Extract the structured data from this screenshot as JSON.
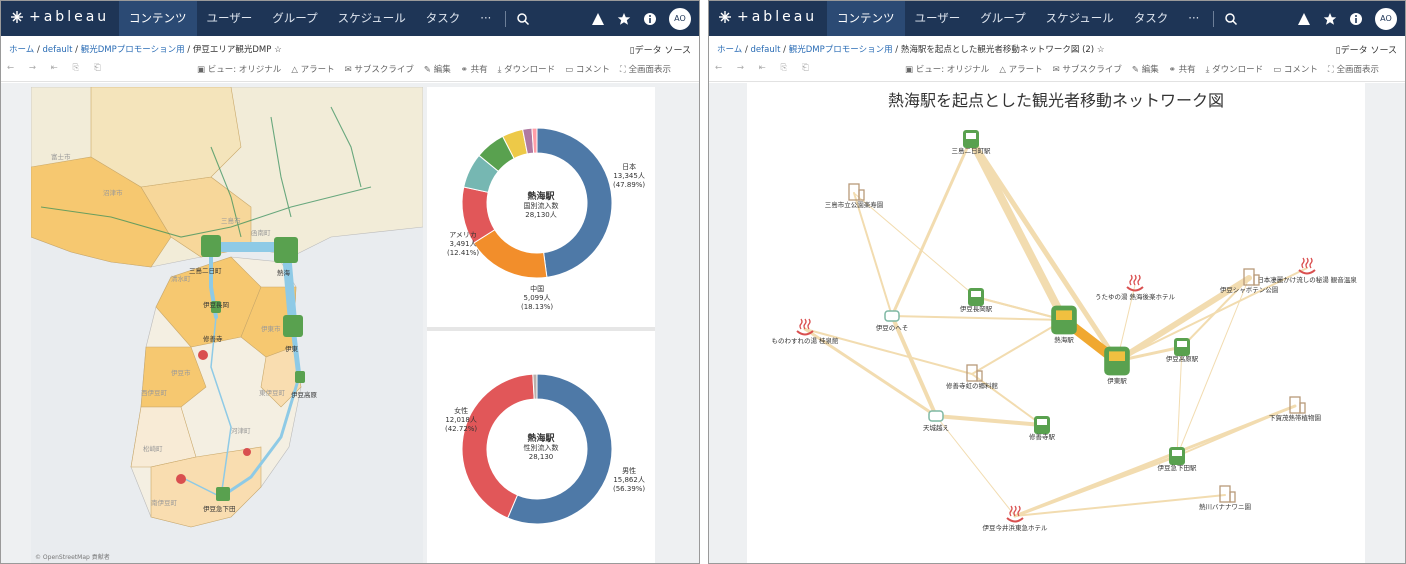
{
  "app": {
    "logo_text": "+ableau",
    "avatar": "AO"
  },
  "nav": {
    "items": [
      "コンテンツ",
      "ユーザー",
      "グループ",
      "スケジュール",
      "タスク",
      "···"
    ]
  },
  "left": {
    "breadcrumb": {
      "home": "ホーム",
      "site": "default",
      "project": "観光DMPプロモーション用",
      "view": "伊豆エリア観光DMP"
    },
    "data_source": "データ ソース",
    "toolbar": [
      "ビュー: オリジナル",
      "アラート",
      "サブスクライブ",
      "編集",
      "共有",
      "ダウンロード",
      "コメント",
      "全画面表示"
    ],
    "map_labels": [
      "三島二日町",
      "熱海",
      "伊豆長岡",
      "修善寺",
      "伊東",
      "伊豆高原",
      "伊豆急下田"
    ],
    "map_places": [
      "富士市",
      "沼津市",
      "伊豆市",
      "伊東市",
      "東伊豆町",
      "河津町",
      "南伊豆町",
      "松崎町",
      "西伊豆町",
      "三島市",
      "函南町",
      "清水町"
    ],
    "attribution": "© OpenStreetMap 貢献者",
    "donut1": {
      "center_title": "熱海駅",
      "center_sub": "国別流入数",
      "center_value": "28,130人",
      "slices": [
        {
          "name": "日本",
          "value": "13,345人",
          "pct": "(47.89%)",
          "color": "#4e79a7"
        },
        {
          "name": "中国",
          "value": "5,099人",
          "pct": "(18.13%)",
          "color": "#f28e2b"
        },
        {
          "name": "アメリカ",
          "value": "3,491人",
          "pct": "(12.41%)",
          "color": "#e15759"
        },
        {
          "name": "",
          "value": "",
          "pct": "",
          "color": "#76b7b2"
        },
        {
          "name": "",
          "value": "",
          "pct": "",
          "color": "#59a14f"
        },
        {
          "name": "",
          "value": "",
          "pct": "",
          "color": "#edc948"
        },
        {
          "name": "",
          "value": "",
          "pct": "",
          "color": "#b07aa1"
        },
        {
          "name": "",
          "value": "",
          "pct": "",
          "color": "#ff9da7"
        }
      ],
      "shares": [
        47.89,
        18.13,
        12.41,
        7.5,
        6.5,
        4.5,
        2.0,
        1.07
      ]
    },
    "donut2": {
      "center_title": "熱海駅",
      "center_sub": "性別流入数",
      "center_value": "28,130",
      "slices": [
        {
          "name": "男性",
          "value": "15,862人",
          "pct": "(56.39%)",
          "color": "#4e79a7"
        },
        {
          "name": "女性",
          "value": "12,018人",
          "pct": "(42.72%)",
          "color": "#e15759"
        },
        {
          "name": "",
          "value": "",
          "pct": "",
          "color": "#bab0ac"
        }
      ],
      "shares": [
        56.39,
        42.72,
        0.89
      ]
    }
  },
  "right": {
    "breadcrumb": {
      "home": "ホーム",
      "site": "default",
      "project": "観光DMPプロモーション用",
      "view": "熱海駅を起点とした観光者移動ネットワーク図 (2)"
    },
    "data_source": "データ ソース",
    "toolbar": [
      "ビュー: オリジナル",
      "アラート",
      "サブスクライブ",
      "編集",
      "共有",
      "ダウンロード",
      "コメント",
      "全画面表示"
    ],
    "title": "熱海駅を起点とした観光者移動ネットワーク図",
    "nodes": [
      {
        "label": "三島二日町駅",
        "kind": "station"
      },
      {
        "label": "三島市立公園楽寿園",
        "kind": "building"
      },
      {
        "label": "伊豆長岡駅",
        "kind": "station"
      },
      {
        "label": "伊豆のへそ",
        "kind": "bus"
      },
      {
        "label": "ものわすれの湯 桂泉館",
        "kind": "onsen"
      },
      {
        "label": "熱海駅",
        "kind": "station-big"
      },
      {
        "label": "伊東駅",
        "kind": "station-big"
      },
      {
        "label": "うたゆの湯 熱海後楽ホテル",
        "kind": "onsen"
      },
      {
        "label": "日本凄麗かけ流しの秘湯 観音温泉",
        "kind": "onsen"
      },
      {
        "label": "伊豆シャボテン公園",
        "kind": "building"
      },
      {
        "label": "伊豆高原駅",
        "kind": "station"
      },
      {
        "label": "修善寺虹の郷料館",
        "kind": "building"
      },
      {
        "label": "天城越え",
        "kind": "bus"
      },
      {
        "label": "修善寺駅",
        "kind": "station"
      },
      {
        "label": "下賀茂熱帯植物園",
        "kind": "building"
      },
      {
        "label": "伊豆急下田駅",
        "kind": "station"
      },
      {
        "label": "熱川バナナワニ園",
        "kind": "building"
      },
      {
        "label": "伊豆今井浜東急ホテル",
        "kind": "onsen"
      }
    ]
  }
}
